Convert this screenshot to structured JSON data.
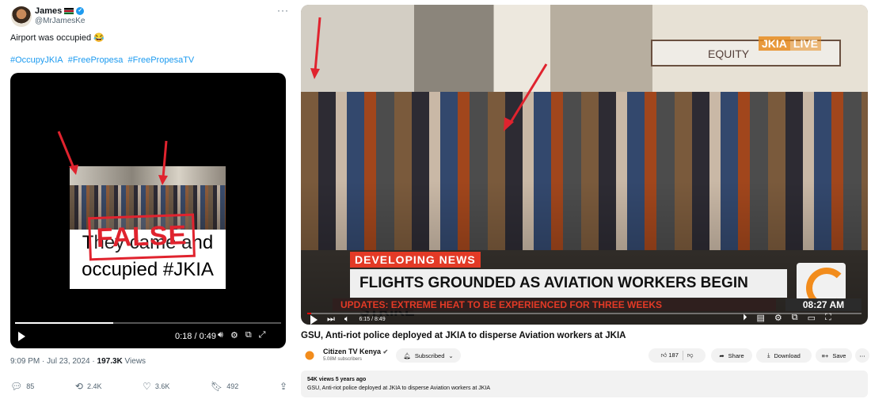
{
  "tweet": {
    "author_name": "James",
    "author_handle": "@MrJamesKe",
    "text": "Airport was occupied 😂",
    "hashtags": [
      "#OccupyJKIA",
      "#FreePropesa",
      "#FreePropesaTV"
    ],
    "video": {
      "caption": "They came and occupied #JKIA",
      "stamp": "FALSE",
      "time": "0:18 / 0:49",
      "progress_fraction": 0.37
    },
    "timestamp": "9:09 PM · Jul 23, 2024 · ",
    "views_count": "197.3K",
    "views_label": " Views",
    "actions": {
      "replies": "85",
      "reposts": "2.4K",
      "likes": "3.6K",
      "bookmarks": "492"
    }
  },
  "youtube": {
    "overlay": {
      "live_a": "JKIA",
      "live_b": "LIVE",
      "sign": "EQUITY",
      "banner": "DEVELOPING NEWS",
      "headline": "FLIGHTS GROUNDED AS AVIATION WORKERS BEGIN STRIKE",
      "ticker": "UPDATES: EXTREME HEAT TO BE EXPERIENCED FOR THREE WEEKS",
      "clock": "08:27 AM"
    },
    "player": {
      "time": "6:15 / 8:49"
    },
    "title": "GSU, Anti-riot police deployed at JKIA to disperse Aviation workers at JKIA",
    "channel": {
      "name": "Citizen TV Kenya",
      "subscribers": "5.08M subscribers",
      "subscribed_label": "Subscribed"
    },
    "actions": {
      "likes": "187",
      "share": "Share",
      "download": "Download",
      "save": "Save"
    },
    "description": {
      "stats": "54K views  5 years ago",
      "text": "GSU, Anti-riot police deployed at JKIA to disperse Aviation workers at JKIA"
    }
  },
  "colors": {
    "annotation_red": "#e0232e",
    "twitter_blue": "#1d9bf0",
    "news_orange": "#f28c1c"
  }
}
